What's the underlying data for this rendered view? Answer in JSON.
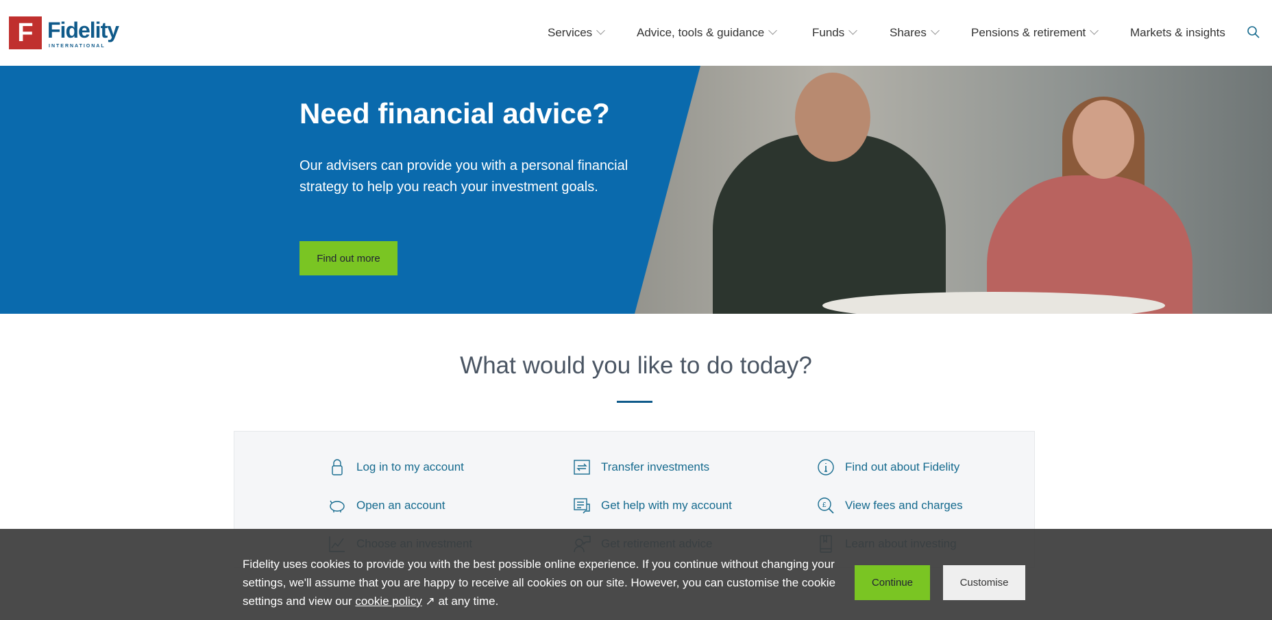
{
  "header": {
    "logo_text": "Fidelity",
    "logo_sub": "INTERNATIONAL",
    "logo_mark": "F",
    "nav": [
      {
        "label": "Services",
        "dropdown": true
      },
      {
        "label": "Advice, tools & guidance",
        "dropdown": true
      },
      {
        "label": "Funds",
        "dropdown": true
      },
      {
        "label": "Shares",
        "dropdown": true
      },
      {
        "label": "Pensions & retirement",
        "dropdown": true
      },
      {
        "label": "Markets & insights",
        "dropdown": false
      }
    ],
    "search_icon": "search-icon"
  },
  "hero": {
    "title": "Need financial advice?",
    "text": "Our advisers can provide you with a personal financial strategy to help you reach your investment goals.",
    "button": "Find out more",
    "bg_color": "#0a6aad"
  },
  "tasks": {
    "heading": "What would you like to do today?",
    "items": [
      {
        "label": "Log in to my account",
        "icon": "lock-icon"
      },
      {
        "label": "Transfer investments",
        "icon": "transfer-icon"
      },
      {
        "label": "Find out about Fidelity",
        "icon": "info-icon"
      },
      {
        "label": "Open an account",
        "icon": "piggy-bank-icon"
      },
      {
        "label": "Get help with my account",
        "icon": "help-chat-icon"
      },
      {
        "label": "View fees and charges",
        "icon": "fees-magnifier-icon"
      },
      {
        "label": "Choose an investment",
        "icon": "chart-icon"
      },
      {
        "label": "Get retirement advice",
        "icon": "adviser-icon"
      },
      {
        "label": "Learn about investing",
        "icon": "book-icon"
      }
    ]
  },
  "cookie": {
    "text_before": "Fidelity uses cookies to provide you with the best possible online experience. If you continue without changing your settings, we'll assume that you are happy to receive all cookies on our site. However, you can customise the cookie settings and view our ",
    "link": "cookie policy",
    "text_after": " at any time.",
    "continue": "Continue",
    "customise": "Customise",
    "accent": "#7ac523"
  }
}
